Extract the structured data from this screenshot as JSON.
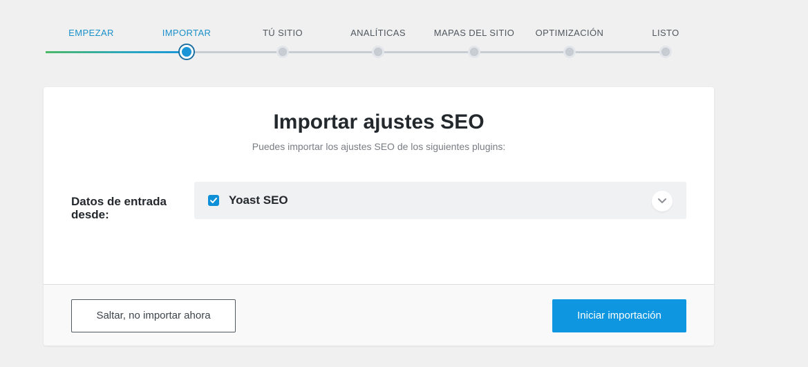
{
  "steps": [
    {
      "label": "EMPEZAR",
      "state": "done"
    },
    {
      "label": "IMPORTAR",
      "state": "active"
    },
    {
      "label": "TÚ SITIO",
      "state": "pending"
    },
    {
      "label": "ANALÍTICAS",
      "state": "pending"
    },
    {
      "label": "MAPAS DEL SITIO",
      "state": "pending"
    },
    {
      "label": "OPTIMIZACIÓN",
      "state": "pending"
    },
    {
      "label": "LISTO",
      "state": "pending"
    }
  ],
  "card": {
    "title": "Importar ajustes SEO",
    "subtitle": "Puedes importar los ajustes SEO de los siguientes plugins:",
    "source_label": "Datos de entrada desde:",
    "plugin": {
      "name": "Yoast SEO",
      "checked": true
    }
  },
  "footer": {
    "skip_label": "Saltar, no importar ahora",
    "start_label": "Iniciar importación"
  },
  "colors": {
    "accent": "#0e96e0",
    "progress_start": "#4bb866",
    "active_step": "#1a8fc9"
  }
}
